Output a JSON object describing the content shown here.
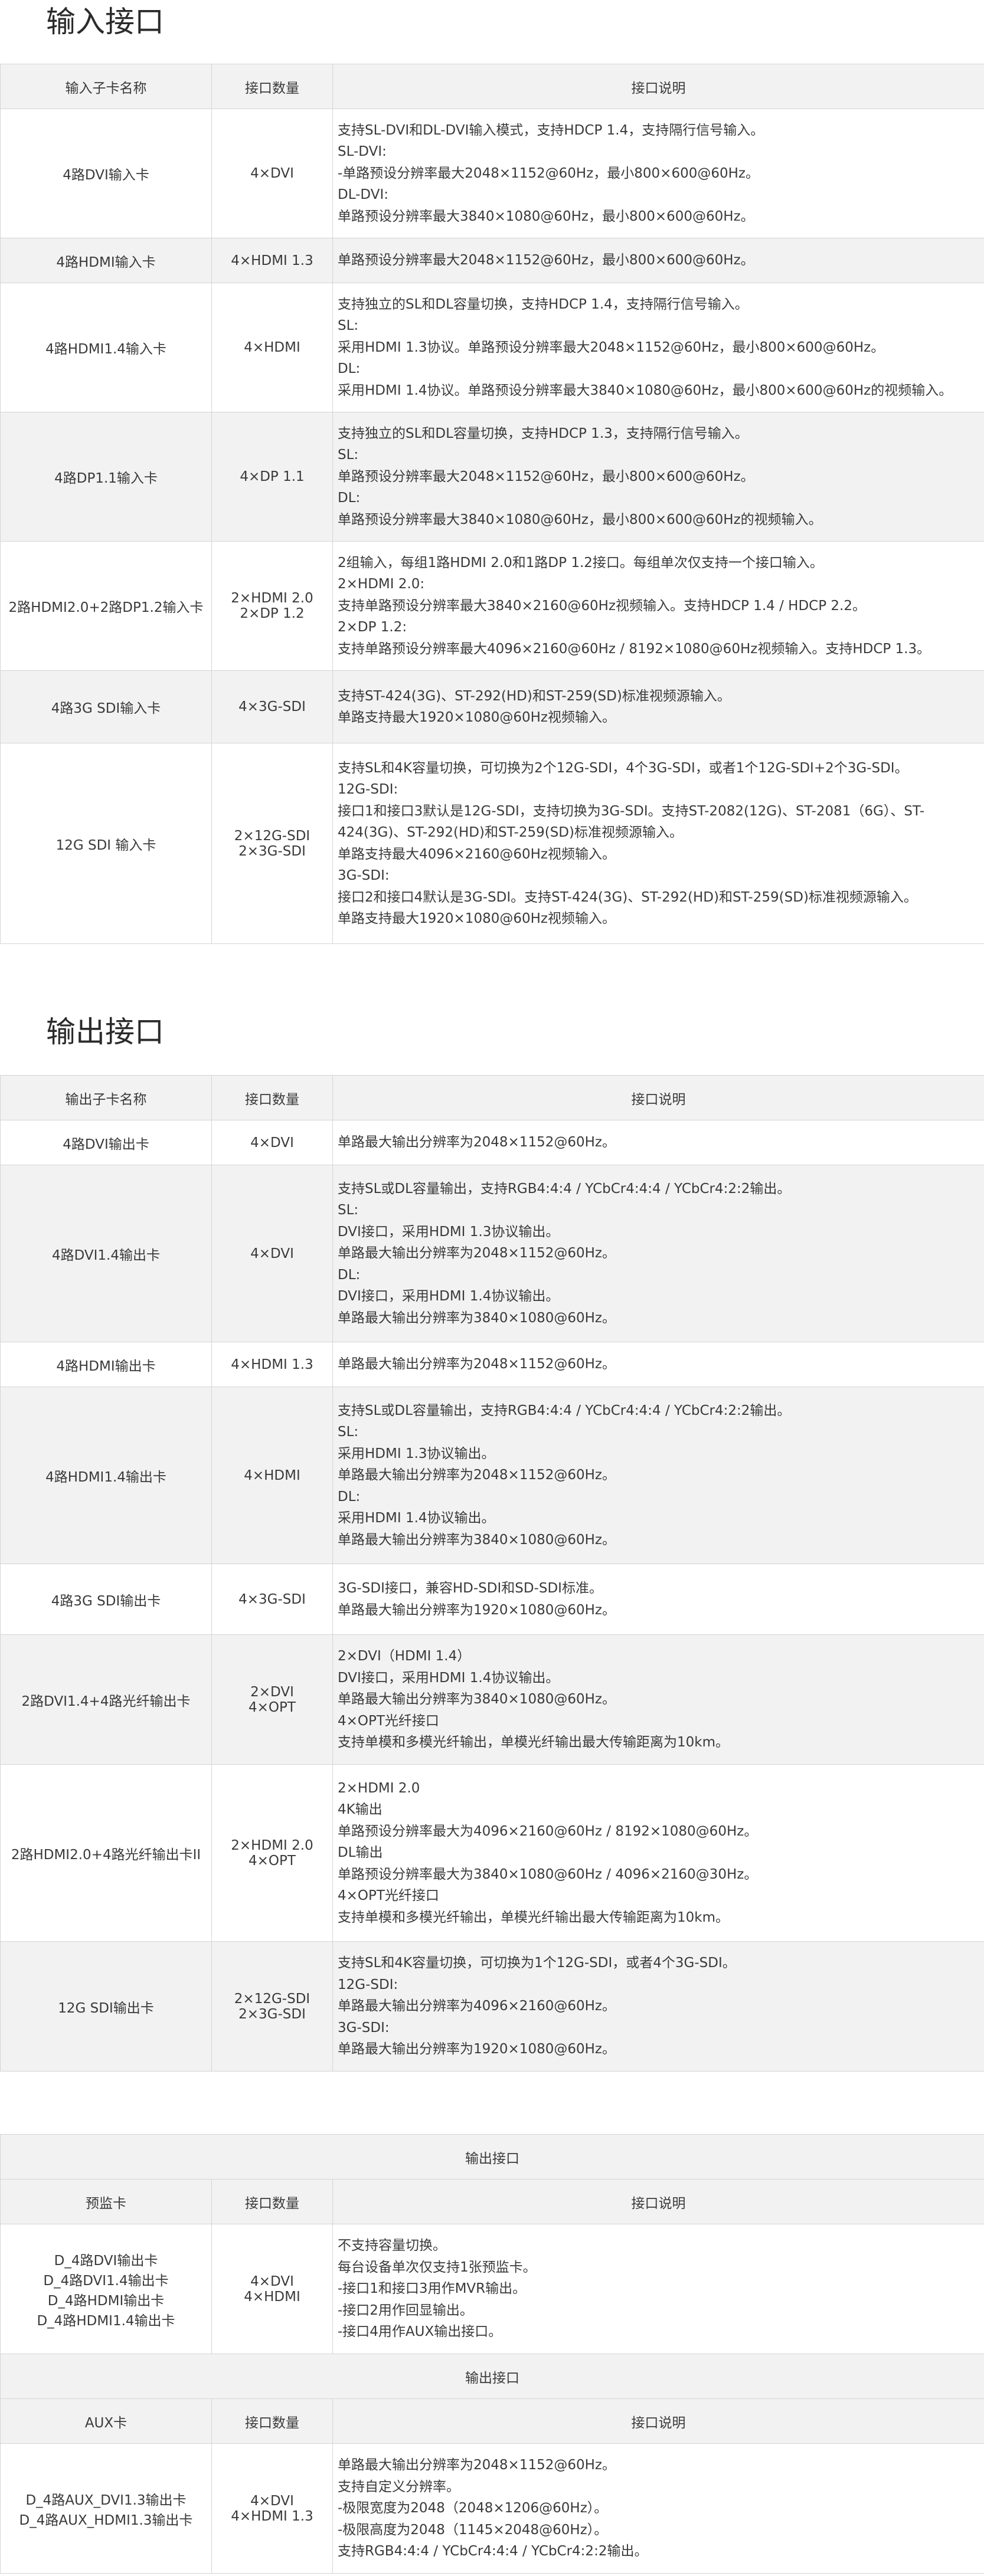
{
  "input_section": {
    "title": "输入接口",
    "headers": [
      "输入子卡名称",
      "接口数量",
      "接口说明"
    ],
    "rows": [
      {
        "name": [
          "4路DVI输入卡"
        ],
        "count": [
          "4×DVI"
        ],
        "desc": [
          "支持SL-DVI和DL-DVI输入模式，支持HDCP 1.4，支持隔行信号输入。",
          "SL-DVI:",
          "-单路预设分辨率最大2048×1152@60Hz，最小800×600@60Hz。",
          "DL-DVI:",
          "单路预设分辨率最大3840×1080@60Hz，最小800×600@60Hz。"
        ]
      },
      {
        "name": [
          "4路HDMI输入卡"
        ],
        "count": [
          "4×HDMI 1.3"
        ],
        "desc": [
          "单路预设分辨率最大2048×1152@60Hz，最小800×600@60Hz。"
        ]
      },
      {
        "name": [
          "4路HDMI1.4输入卡"
        ],
        "count": [
          "4×HDMI"
        ],
        "desc": [
          "支持独立的SL和DL容量切换，支持HDCP 1.4，支持隔行信号输入。",
          "SL:",
          "采用HDMI 1.3协议。单路预设分辨率最大2048×1152@60Hz，最小800×600@60Hz。",
          "DL:",
          "采用HDMI 1.4协议。单路预设分辨率最大3840×1080@60Hz，最小800×600@60Hz的视频输入。"
        ]
      },
      {
        "name": [
          "4路DP1.1输入卡"
        ],
        "count": [
          "4×DP 1.1"
        ],
        "desc": [
          "支持独立的SL和DL容量切换，支持HDCP 1.3，支持隔行信号输入。",
          "SL:",
          "单路预设分辨率最大2048×1152@60Hz，最小800×600@60Hz。",
          "DL:",
          "单路预设分辨率最大3840×1080@60Hz，最小800×600@60Hz的视频输入。"
        ]
      },
      {
        "name": [
          "2路HDMI2.0+2路DP1.2输入卡"
        ],
        "count": [
          "2×HDMI 2.0",
          "2×DP 1.2"
        ],
        "desc": [
          "2组输入，每组1路HDMI 2.0和1路DP 1.2接口。每组单次仅支持一个接口输入。",
          "2×HDMI 2.0:",
          "支持单路预设分辨率最大3840×2160@60Hz视频输入。支持HDCP 1.4 / HDCP 2.2。",
          "2×DP 1.2:",
          "支持单路预设分辨率最大4096×2160@60Hz / 8192×1080@60Hz视频输入。支持HDCP 1.3。"
        ]
      },
      {
        "name": [
          "4路3G SDI输入卡"
        ],
        "count": [
          "4×3G-SDI"
        ],
        "desc": [
          "支持ST-424(3G)、ST-292(HD)和ST-259(SD)标准视频源输入。",
          "单路支持最大1920×1080@60Hz视频输入。"
        ]
      },
      {
        "name": [
          "12G SDI 输入卡"
        ],
        "count": [
          "2×12G-SDI",
          "2×3G-SDI"
        ],
        "desc": [
          "支持SL和4K容量切换，可切换为2个12G-SDI，4个3G-SDI，或者1个12G-SDI+2个3G-SDI。",
          "12G-SDI:",
          "接口1和接口3默认是12G-SDI，支持切换为3G-SDI。支持ST-2082(12G)、ST-2081（6G）、ST-424(3G)、ST-292(HD)和ST-259(SD)标准视频源输入。",
          "单路支持最大4096×2160@60Hz视频输入。",
          "3G-SDI:",
          "接口2和接口4默认是3G-SDI。支持ST-424(3G)、ST-292(HD)和ST-259(SD)标准视频源输入。",
          "单路支持最大1920×1080@60Hz视频输入。"
        ]
      }
    ]
  },
  "output_section": {
    "title": "输出接口",
    "headers": [
      "输出子卡名称",
      "接口数量",
      "接口说明"
    ],
    "rows": [
      {
        "name": [
          "4路DVI输出卡"
        ],
        "count": [
          "4×DVI"
        ],
        "desc": [
          "单路最大输出分辨率为2048×1152@60Hz。"
        ]
      },
      {
        "name": [
          "4路DVI1.4输出卡"
        ],
        "count": [
          "4×DVI"
        ],
        "desc": [
          "支持SL或DL容量输出，支持RGB4:4:4 / YCbCr4:4:4 / YCbCr4:2:2输出。",
          "SL:",
          "DVI接口，采用HDMI 1.3协议输出。",
          "单路最大输出分辨率为2048×1152@60Hz。",
          "DL:",
          "DVI接口，采用HDMI 1.4协议输出。",
          "单路最大输出分辨率为3840×1080@60Hz。"
        ]
      },
      {
        "name": [
          "4路HDMI输出卡"
        ],
        "count": [
          "4×HDMI 1.3"
        ],
        "desc": [
          "单路最大输出分辨率为2048×1152@60Hz。"
        ]
      },
      {
        "name": [
          "4路HDMI1.4输出卡"
        ],
        "count": [
          "4×HDMI"
        ],
        "desc": [
          "支持SL或DL容量输出，支持RGB4:4:4 / YCbCr4:4:4 / YCbCr4:2:2输出。",
          "SL:",
          "采用HDMI 1.3协议输出。",
          "单路最大输出分辨率为2048×1152@60Hz。",
          "DL:",
          "采用HDMI 1.4协议输出。",
          "单路最大输出分辨率为3840×1080@60Hz。"
        ]
      },
      {
        "name": [
          "4路3G SDI输出卡"
        ],
        "count": [
          "4×3G-SDI"
        ],
        "desc": [
          "3G-SDI接口，兼容HD-SDI和SD-SDI标准。",
          "单路最大输出分辨率为1920×1080@60Hz。"
        ]
      },
      {
        "name": [
          "2路DVI1.4+4路光纤输出卡"
        ],
        "count": [
          "2×DVI",
          "4×OPT"
        ],
        "desc": [
          "2×DVI（HDMI 1.4）",
          "DVI接口，采用HDMI 1.4协议输出。",
          "单路最大输出分辨率为3840×1080@60Hz。",
          "4×OPT光纤接口",
          "支持单模和多模光纤输出，单模光纤输出最大传输距离为10km。"
        ]
      },
      {
        "name": [
          "2路HDMI2.0+4路光纤输出卡II"
        ],
        "count": [
          "2×HDMI 2.0",
          "4×OPT"
        ],
        "desc": [
          "2×HDMI 2.0",
          "4K输出",
          "单路预设分辨率最大为4096×2160@60Hz / 8192×1080@60Hz。",
          "DL输出",
          "单路预设分辨率最大为3840×1080@60Hz / 4096×2160@30Hz。",
          "4×OPT光纤接口",
          "支持单模和多模光纤输出，单模光纤输出最大传输距离为10km。"
        ]
      },
      {
        "name": [
          "12G SDI输出卡"
        ],
        "count": [
          "2×12G-SDI",
          "2×3G-SDI"
        ],
        "desc": [
          "支持SL和4K容量切换，可切换为1个12G-SDI，或者4个3G-SDI。",
          "12G-SDI:",
          "单路最大输出分辨率为4096×2160@60Hz。",
          "3G-SDI:",
          "单路最大输出分辨率为1920×1080@60Hz。"
        ]
      }
    ]
  },
  "preview_section": {
    "title": "输出接口",
    "headers": [
      "预监卡",
      "接口数量",
      "接口说明"
    ],
    "rows": [
      {
        "name": [
          "D_4路DVI输出卡",
          "D_4路DVI1.4输出卡",
          "D_4路HDMI输出卡",
          "D_4路HDMI1.4输出卡"
        ],
        "count": [
          "4×DVI",
          "4×HDMI"
        ],
        "desc": [
          "不支持容量切换。",
          "每台设备单次仅支持1张预监卡。",
          "-接口1和接口3用作MVR输出。",
          "-接口2用作回显输出。",
          "-接口4用作AUX输出接口。"
        ]
      }
    ]
  },
  "aux_section": {
    "title": "输出接口",
    "headers": [
      "AUX卡",
      "接口数量",
      "接口说明"
    ],
    "rows": [
      {
        "name": [
          "D_4路AUX_DVI1.3输出卡",
          "D_4路AUX_HDMI1.3输出卡"
        ],
        "count": [
          "4×DVI",
          "4×HDMI 1.3"
        ],
        "desc": [
          "单路最大输出分辨率为2048×1152@60Hz。",
          "支持自定义分辨率。",
          "-极限宽度为2048（2048×1206@60Hz）。",
          "-极限高度为2048（1145×2048@60Hz）。",
          "支持RGB4:4:4 / YCbCr4:4:4 / YCbCr4:2:2输出。"
        ]
      }
    ]
  }
}
